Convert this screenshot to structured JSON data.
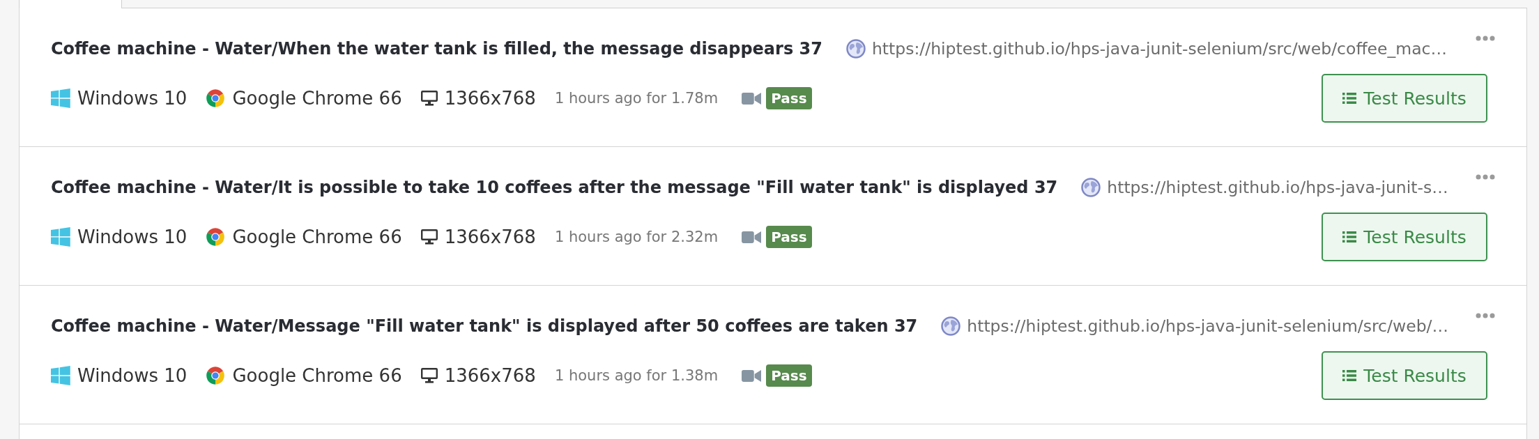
{
  "tabs": [
    {
      "selected": true
    }
  ],
  "runs": [
    {
      "title": "Coffee machine - Water/When the water tank is filled, the message disappears 37",
      "url": "https://hiptest.github.io/hps-java-junit-selenium/src/web/coffee_mac…",
      "os": "Windows 10",
      "browser": "Google Chrome 66",
      "resolution": "1366x768",
      "timing": "1 hours ago for 1.78m",
      "status": "Pass",
      "button": "Test Results"
    },
    {
      "title": "Coffee machine - Water/It is possible to take 10 coffees after the message \"Fill water tank\" is displayed 37",
      "url": "https://hiptest.github.io/hps-java-junit-s…",
      "os": "Windows 10",
      "browser": "Google Chrome 66",
      "resolution": "1366x768",
      "timing": "1 hours ago for 2.32m",
      "status": "Pass",
      "button": "Test Results"
    },
    {
      "title": "Coffee machine - Water/Message \"Fill water tank\" is displayed after 50 coffees are taken 37",
      "url": "https://hiptest.github.io/hps-java-junit-selenium/src/web/…",
      "os": "Windows 10",
      "browser": "Google Chrome 66",
      "resolution": "1366x768",
      "timing": "1 hours ago for 1.38m",
      "status": "Pass",
      "button": "Test Results"
    }
  ]
}
